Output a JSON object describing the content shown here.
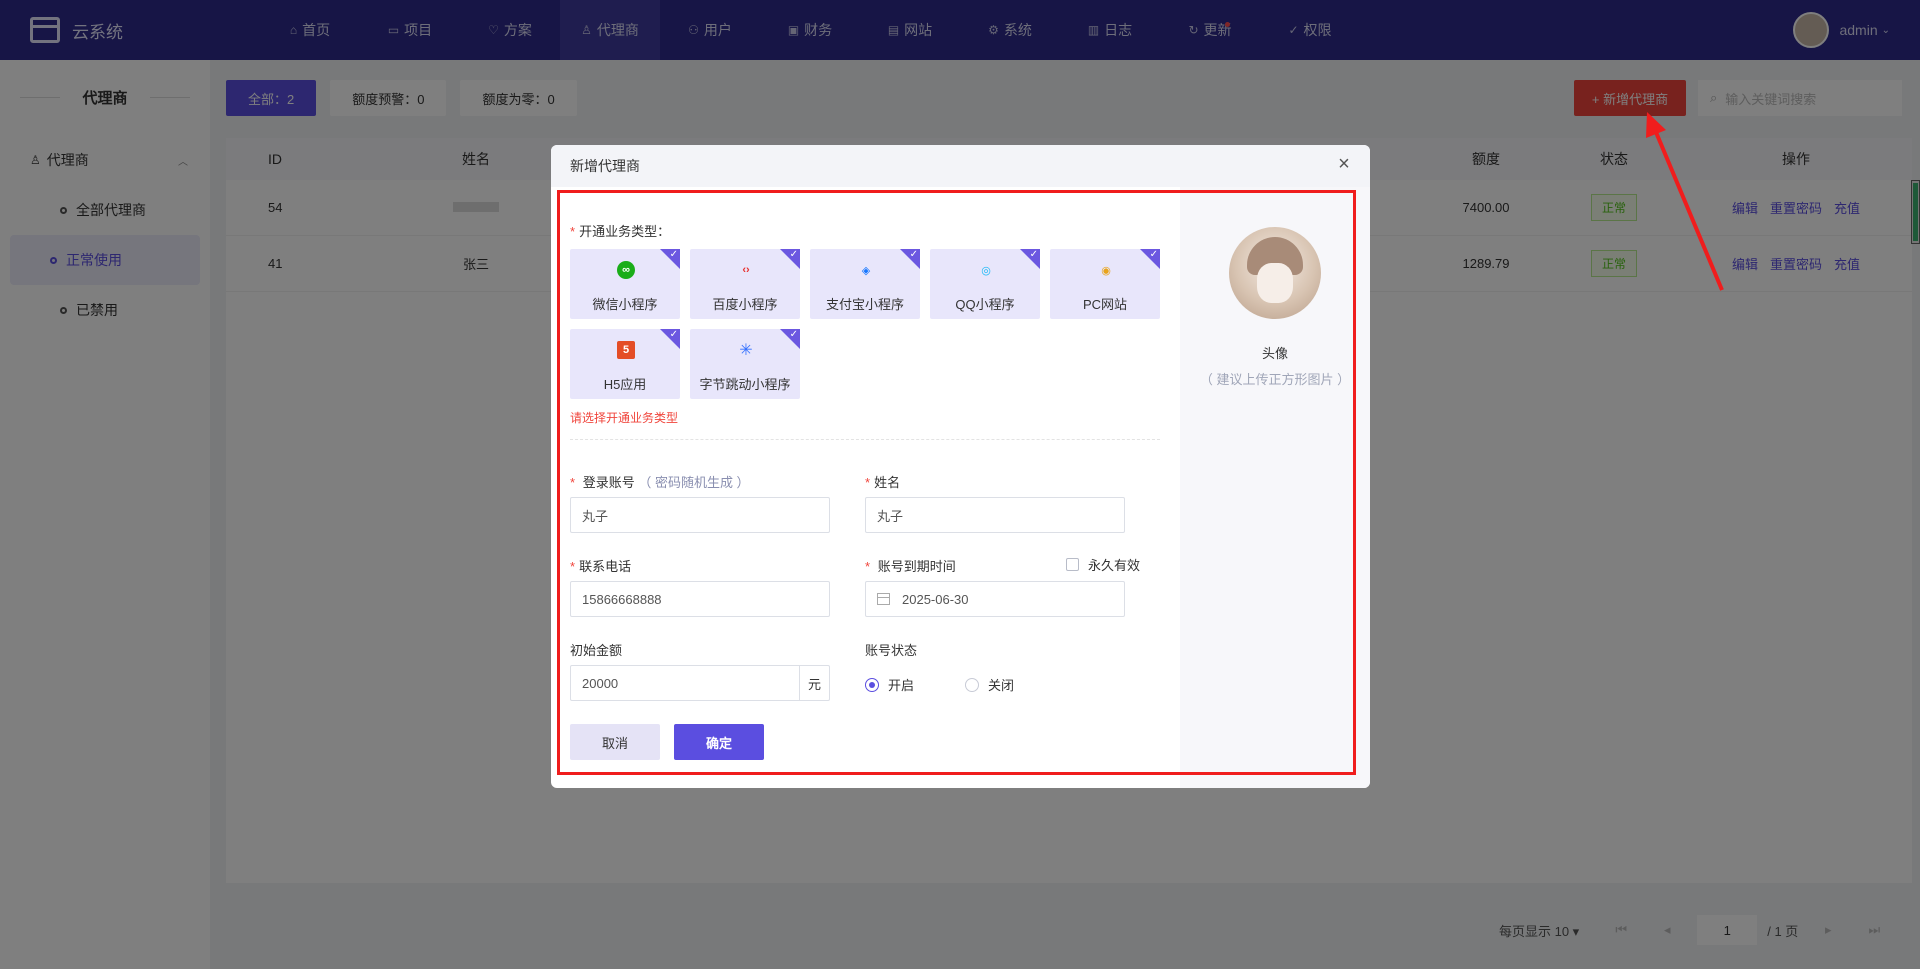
{
  "app": {
    "title": "云系统",
    "user": "admin",
    "nav": [
      {
        "label": "首页",
        "icon": "⌂"
      },
      {
        "label": "项目",
        "icon": "▭"
      },
      {
        "label": "方案",
        "icon": "♡"
      },
      {
        "label": "代理商",
        "icon": "♙"
      },
      {
        "label": "用户",
        "icon": "⚇"
      },
      {
        "label": "财务",
        "icon": "▣"
      },
      {
        "label": "网站",
        "icon": "▤"
      },
      {
        "label": "系统",
        "icon": "⚙"
      },
      {
        "label": "日志",
        "icon": "▥"
      },
      {
        "label": "更新",
        "icon": "↻"
      },
      {
        "label": "权限",
        "icon": "✓"
      }
    ]
  },
  "sidebar": {
    "title": "代理商",
    "group": "代理商",
    "items": [
      {
        "label": "全部代理商"
      },
      {
        "label": "正常使用"
      },
      {
        "label": "已禁用"
      }
    ]
  },
  "toolbar": {
    "filters": [
      "全部：2",
      "额度预警：0",
      "额度为零：0"
    ],
    "add_label": "+ 新增代理商",
    "search_placeholder": "输入关键词搜索"
  },
  "table": {
    "headers": {
      "id": "ID",
      "name": "姓名",
      "amount": "额度",
      "status": "状态",
      "ops": "操作"
    },
    "rows": [
      {
        "id": "54",
        "name": "",
        "amount": "7400.00",
        "status": "正常"
      },
      {
        "id": "41",
        "name": "张三",
        "amount": "1289.79",
        "status": "正常"
      }
    ],
    "ops": [
      "编辑",
      "重置密码",
      "充值"
    ]
  },
  "pager": {
    "page_size": "每页显示 10 ▾",
    "page": "1",
    "total": "/ 1 页"
  },
  "modal": {
    "title": "新增代理商",
    "close": "×",
    "biz_label": "开通业务类型：",
    "biz_items": [
      {
        "label": "微信小程序",
        "glyph": "∞",
        "color": "#1aad19"
      },
      {
        "label": "百度小程序",
        "glyph": "‹›",
        "color": "#e8312e"
      },
      {
        "label": "支付宝小程序",
        "glyph": "◈",
        "color": "#1677ff"
      },
      {
        "label": "QQ小程序",
        "glyph": "◎",
        "color": "#12b7f5"
      },
      {
        "label": "PC网站",
        "glyph": "◉",
        "color": "#e8a31b"
      },
      {
        "label": "H5应用",
        "glyph": "5",
        "color": "#e44d26"
      },
      {
        "label": "字节跳动小程序",
        "glyph": "✳",
        "color": "#3370ff"
      }
    ],
    "biz_error": "请选择开通业务类型",
    "account_label": "登录账号",
    "account_hint": "（ 密码随机生成 ）",
    "account_value": "丸子",
    "name_label": "姓名",
    "name_value": "丸子",
    "phone_label": "联系电话",
    "phone_value": "15866668888",
    "expire_label": "账号到期时间",
    "forever_label": "永久有效",
    "expire_value": "2025-06-30",
    "amount_label": "初始金额",
    "amount_value": "20000",
    "amount_unit": "元",
    "status_label": "账号状态",
    "status_on": "开启",
    "status_off": "关闭",
    "cancel": "取消",
    "confirm": "确定",
    "avatar_label": "头像",
    "avatar_hint": "（ 建议上传正方形图片 ）"
  }
}
